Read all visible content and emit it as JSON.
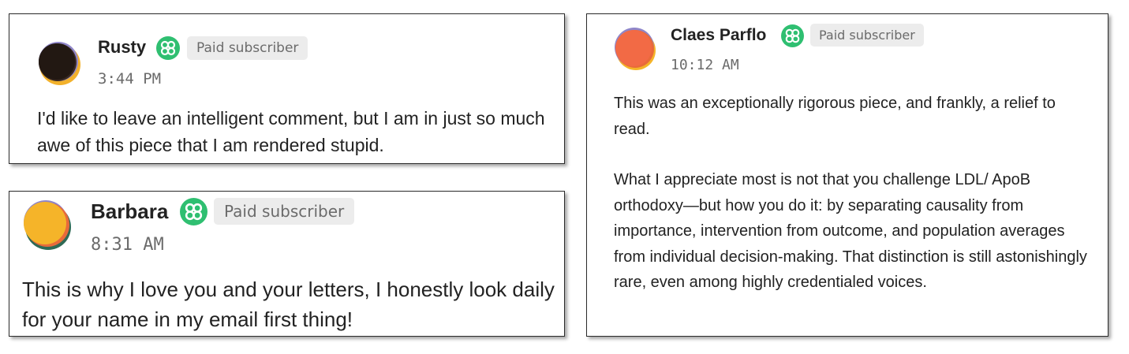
{
  "badge_icon": "flower-badge-icon",
  "colors": {
    "badge": "#2fbf71",
    "pill_bg": "#ececec",
    "pill_text": "#6b6b6b",
    "border": "#2b2b2b"
  },
  "comments": [
    {
      "author": "Rusty",
      "badge_label": "Paid subscriber",
      "time": "3:44 PM",
      "body": [
        "I'd like to leave an intelligent comment, but I am in just so much awe of this piece that I am rendered stupid."
      ]
    },
    {
      "author": "Barbara",
      "badge_label": "Paid subscriber",
      "time": "8:31 AM",
      "body": [
        "This is why I love you and your letters, I honestly look daily for your name in my email first thing!"
      ]
    },
    {
      "author": "Claes Parflo",
      "badge_label": "Paid subscriber",
      "time": "10:12 AM",
      "body": [
        "This was an exceptionally rigorous piece, and frankly, a relief to read.",
        "What I appreciate most is not that you challenge LDL/ ApoB orthodoxy—but how you do it: by separating causality from importance, intervention from outcome, and population averages from individual decision-making. That distinction is still astonishingly rare, even among highly credentialed voices."
      ]
    }
  ]
}
